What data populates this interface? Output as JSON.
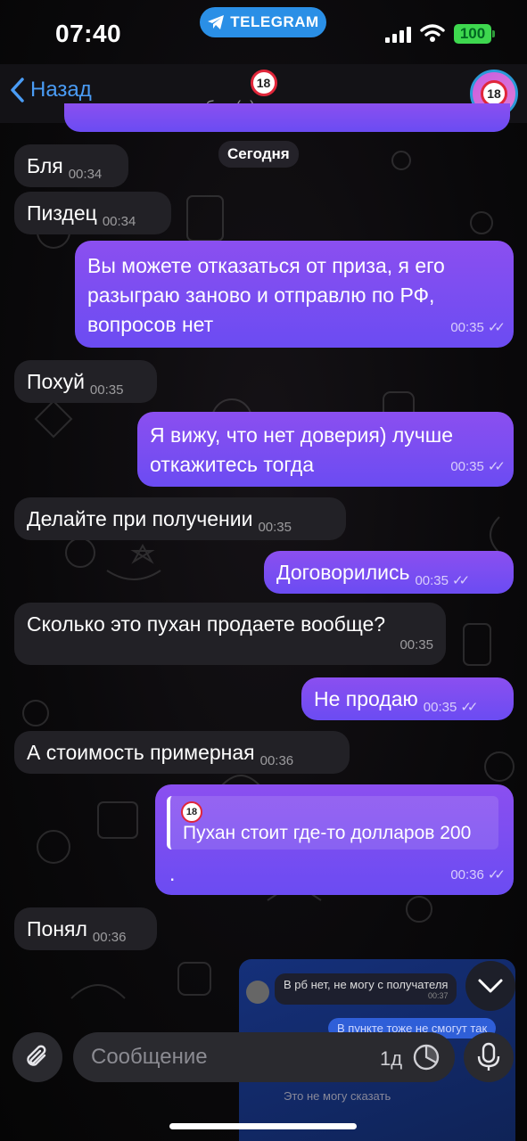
{
  "status_bar": {
    "time": "07:40",
    "app_pill": "TELEGRAM",
    "battery": "100"
  },
  "header": {
    "back_label": "Назад",
    "contact_badge": "18",
    "last_seen": "был(а) недавно",
    "avatar_badge": "18"
  },
  "chat": {
    "date_chip": "Сегодня",
    "messages": [
      {
        "dir": "in",
        "text": "Бля",
        "time": "00:34"
      },
      {
        "dir": "in",
        "text": "Пиздец",
        "time": "00:34"
      },
      {
        "dir": "out",
        "lines": [
          "Вы можете отказаться от приза, я его",
          "разыграю заново и отправлю по РФ,",
          "вопросов нет"
        ],
        "time": "00:35"
      },
      {
        "dir": "in",
        "text": "Похуй",
        "time": "00:35"
      },
      {
        "dir": "out",
        "lines": [
          "Я вижу, что нет доверия) лучше",
          "откажитесь тогда"
        ],
        "time": "00:35"
      },
      {
        "dir": "in",
        "text": "Делайте при получении",
        "time": "00:35"
      },
      {
        "dir": "out",
        "text": "Договорились",
        "time": "00:35"
      },
      {
        "dir": "in",
        "text": "Сколько это пухан продаете вообще?",
        "time": "00:35"
      },
      {
        "dir": "out",
        "text": "Не продаю",
        "time": "00:35"
      },
      {
        "dir": "in",
        "text": "А стоимость примерная",
        "time": "00:36"
      },
      {
        "dir": "out",
        "quote_badge": "18",
        "quote_text": "Пухан стоит где-то долларов 200",
        "text": ".",
        "time": "00:36"
      },
      {
        "dir": "in",
        "text": "Понял",
        "time": "00:36"
      }
    ]
  },
  "preview": {
    "in_text": "В рб нет, не могу с получателя",
    "in_time": "00:37",
    "out_text": "В пункте тоже не смогут так",
    "bottom_text": "Это не могу сказать"
  },
  "input_bar": {
    "placeholder": "Сообщение",
    "timer_label": "1д"
  },
  "colors": {
    "accent": "#4a9cf5",
    "outgoing_top": "#8b4ff0",
    "outgoing_bottom": "#6b4cf2",
    "incoming": "#222126"
  }
}
